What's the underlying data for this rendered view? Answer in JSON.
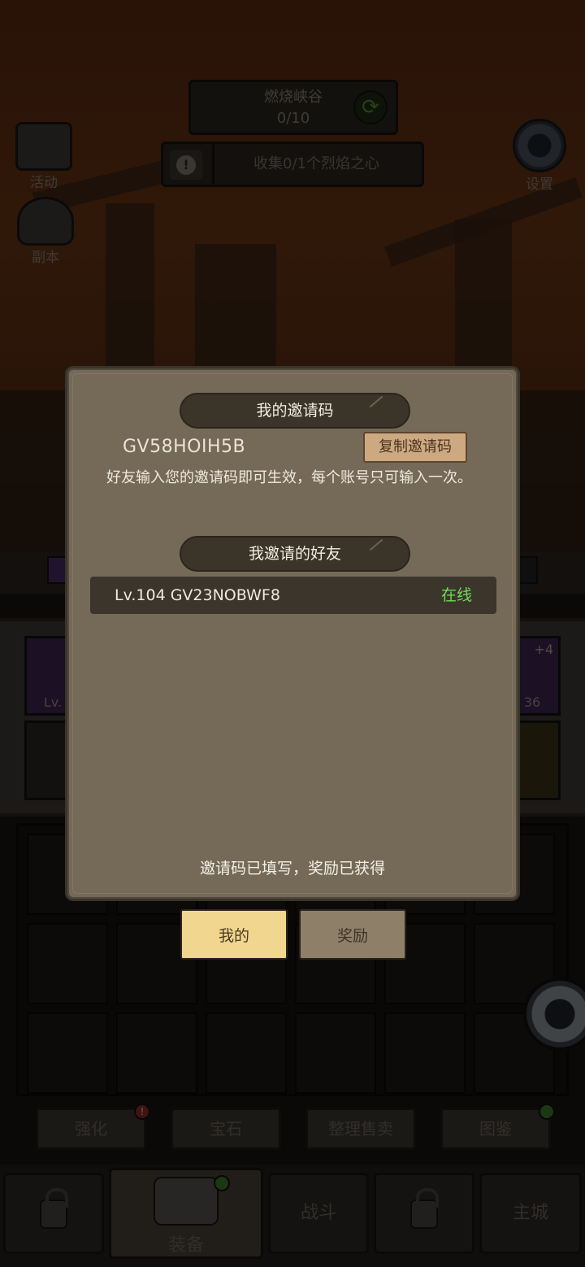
{
  "background": {
    "stage": {
      "name": "燃烧峡谷",
      "progress": "0/10"
    },
    "quest": "收集0/1个烈焰之心",
    "left_menu": [
      {
        "label": "活动"
      },
      {
        "label": "副本"
      }
    ],
    "right_menu": {
      "settings_label": "设置"
    },
    "equip_slots": {
      "left_label": "Lv.",
      "right_badge": "+4",
      "right_label": "36"
    },
    "action_buttons": [
      "强化",
      "宝石",
      "整理售卖",
      "图鉴"
    ],
    "nav_tabs": [
      "装备",
      "战斗",
      "主城"
    ]
  },
  "modal": {
    "my_code_header": "我的邀请码",
    "my_code": "GV58HOIH5B",
    "copy_button": "复制邀请码",
    "description": "好友输入您的邀请码即可生效，每个账号只可输入一次。",
    "friends_header": "我邀请的好友",
    "friends": [
      {
        "name": "Lv.104 GV23NOBWF8",
        "status": "在线"
      }
    ],
    "footer": "邀请码已填写，奖励已获得"
  },
  "tabs": [
    "我的",
    "奖励"
  ],
  "colors": {
    "online": "#6ddc52",
    "active_tab": "#f0d68e",
    "copy_button": "#cda981"
  }
}
